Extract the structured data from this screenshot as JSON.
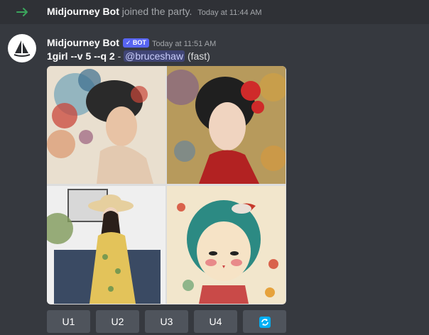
{
  "join": {
    "bot_name": "Midjourney Bot",
    "action": "joined the party.",
    "timestamp": "Today at 11:44 AM"
  },
  "message": {
    "bot_name": "Midjourney Bot",
    "badge": "✓ BOT",
    "timestamp": "Today at 11:51 AM",
    "prompt": "1girl --v 5 --q 2",
    "separator": " - ",
    "mention": "@bruceshaw",
    "speed": "(fast)"
  },
  "buttons": {
    "u1": "U1",
    "u2": "U2",
    "u3": "U3",
    "u4": "U4"
  },
  "colors": {
    "background": "#36393f",
    "join_row": "#2f3136",
    "arrow": "#3ba55c",
    "badge": "#5865f2",
    "button": "#4f545c",
    "reroll_icon": "#00aff4"
  },
  "icons": {
    "join": "arrow-right-icon",
    "reroll": "refresh-icon",
    "avatar": "sailboat-icon"
  }
}
